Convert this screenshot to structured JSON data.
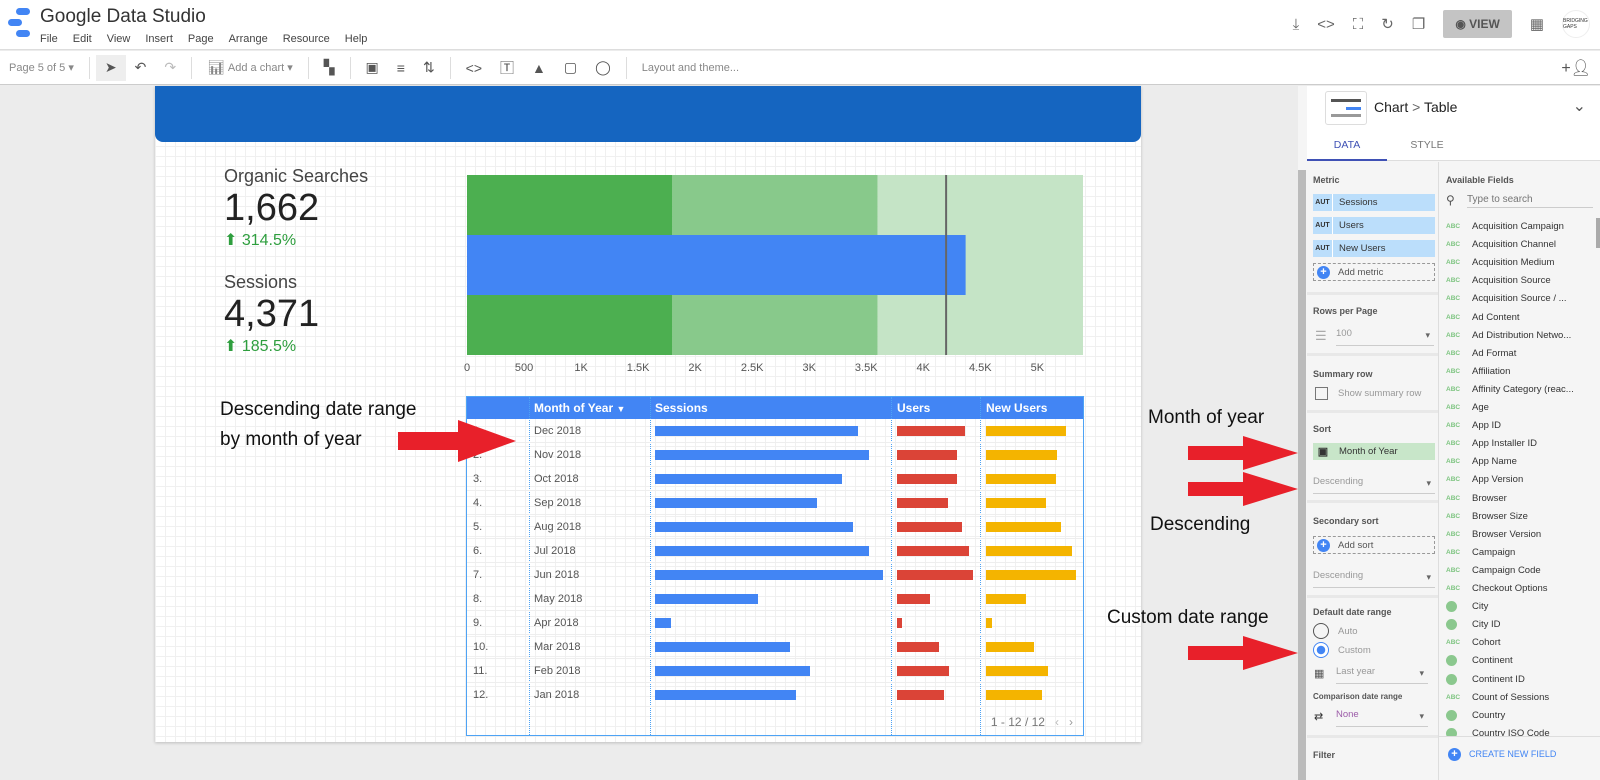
{
  "app": {
    "title": "Google Data Studio",
    "menu": [
      "File",
      "Edit",
      "View",
      "Insert",
      "Page",
      "Arrange",
      "Resource",
      "Help"
    ],
    "view_label": "VIEW",
    "avatar_text": "BRIDGING GAPS"
  },
  "toolbar": {
    "page": "Page 5 of 5",
    "add_chart": "Add a chart",
    "layout_theme": "Layout and theme..."
  },
  "scorecards": [
    {
      "label": "Organic Searches",
      "value": "1,662",
      "delta": "314.5%"
    },
    {
      "label": "Sessions",
      "value": "4,371",
      "delta": "185.5%"
    }
  ],
  "bullet_chart": {
    "value": 4371,
    "target": 4200,
    "bands": [
      1800,
      3600,
      5400
    ],
    "ticks": [
      "0",
      "500",
      "1K",
      "1.5K",
      "2K",
      "2.5K",
      "3K",
      "3.5K",
      "4K",
      "4.5K",
      "5K"
    ],
    "colors": {
      "bar": "#4285f4",
      "band1": "#4caf50",
      "band2": "#88c98b",
      "band3": "#c5e4c6",
      "target": "#666666"
    }
  },
  "table": {
    "columns": [
      "Month of Year",
      "Sessions",
      "Users",
      "New Users"
    ],
    "rows": [
      {
        "n": "1.",
        "month": "Dec 2018",
        "s": 0.89,
        "u": 0.89,
        "nu": 0.89
      },
      {
        "n": "2.",
        "month": "Nov 2018",
        "s": 0.94,
        "u": 0.79,
        "nu": 0.79
      },
      {
        "n": "3.",
        "month": "Oct 2018",
        "s": 0.82,
        "u": 0.79,
        "nu": 0.78
      },
      {
        "n": "4.",
        "month": "Sep 2018",
        "s": 0.71,
        "u": 0.67,
        "nu": 0.67
      },
      {
        "n": "5.",
        "month": "Aug 2018",
        "s": 0.87,
        "u": 0.86,
        "nu": 0.83
      },
      {
        "n": "6.",
        "month": "Jul 2018",
        "s": 0.94,
        "u": 0.95,
        "nu": 0.96
      },
      {
        "n": "7.",
        "month": "Jun 2018",
        "s": 1.0,
        "u": 1.0,
        "nu": 1.0
      },
      {
        "n": "8.",
        "month": "May 2018",
        "s": 0.45,
        "u": 0.43,
        "nu": 0.44
      },
      {
        "n": "9.",
        "month": "Apr 2018",
        "s": 0.07,
        "u": 0.07,
        "nu": 0.07
      },
      {
        "n": "10.",
        "month": "Mar 2018",
        "s": 0.59,
        "u": 0.55,
        "nu": 0.53
      },
      {
        "n": "11.",
        "month": "Feb 2018",
        "s": 0.68,
        "u": 0.68,
        "nu": 0.69
      },
      {
        "n": "12.",
        "month": "Jan 2018",
        "s": 0.62,
        "u": 0.62,
        "nu": 0.62
      }
    ],
    "pager": "1 - 12 / 12",
    "colors": {
      "sessions": "#4285f4",
      "users": "#db4437",
      "new_users": "#f4b400"
    }
  },
  "annotations": {
    "left": "Descending date range\nby month of year",
    "month": "Month of year",
    "desc": "Descending",
    "custom": "Custom date range"
  },
  "panel": {
    "breadcrumb": [
      "Chart",
      "Table"
    ],
    "tabs": [
      "DATA",
      "STYLE"
    ],
    "metric_label": "Metric",
    "metrics": [
      "Sessions",
      "Users",
      "New Users"
    ],
    "metric_type": "AUT",
    "add_metric": "Add metric",
    "rows_label": "Rows per Page",
    "rows_value": "100",
    "summary_label": "Summary row",
    "summary_check": "Show summary row",
    "sort_label": "Sort",
    "sort_field": "Month of Year",
    "sort_order": "Descending",
    "secondary_label": "Secondary sort",
    "add_sort": "Add sort",
    "secondary_order": "Descending",
    "date_label": "Default date range",
    "auto": "Auto",
    "custom": "Custom",
    "date_value": "Last year",
    "comparison_label": "Comparison date range",
    "comparison_value": "None",
    "filter_label": "Filter",
    "fields_label": "Available Fields",
    "search_placeholder": "Type to search",
    "create_field": "CREATE NEW FIELD",
    "fields": [
      {
        "t": "ABC",
        "n": "Acquisition Campaign"
      },
      {
        "t": "ABC",
        "n": "Acquisition Channel"
      },
      {
        "t": "ABC",
        "n": "Acquisition Medium"
      },
      {
        "t": "ABC",
        "n": "Acquisition Source"
      },
      {
        "t": "ABC",
        "n": "Acquisition Source / ..."
      },
      {
        "t": "ABC",
        "n": "Ad Content"
      },
      {
        "t": "ABC",
        "n": "Ad Distribution Netwo..."
      },
      {
        "t": "ABC",
        "n": "Ad Format"
      },
      {
        "t": "ABC",
        "n": "Affiliation"
      },
      {
        "t": "ABC",
        "n": "Affinity Category (reac..."
      },
      {
        "t": "ABC",
        "n": "Age"
      },
      {
        "t": "ABC",
        "n": "App ID"
      },
      {
        "t": "ABC",
        "n": "App Installer ID"
      },
      {
        "t": "ABC",
        "n": "App Name"
      },
      {
        "t": "ABC",
        "n": "App Version"
      },
      {
        "t": "ABC",
        "n": "Browser"
      },
      {
        "t": "ABC",
        "n": "Browser Size"
      },
      {
        "t": "ABC",
        "n": "Browser Version"
      },
      {
        "t": "ABC",
        "n": "Campaign"
      },
      {
        "t": "ABC",
        "n": "Campaign Code"
      },
      {
        "t": "ABC",
        "n": "Checkout Options"
      },
      {
        "t": "geo",
        "n": "City"
      },
      {
        "t": "geo",
        "n": "City ID"
      },
      {
        "t": "ABC",
        "n": "Cohort"
      },
      {
        "t": "geo",
        "n": "Continent"
      },
      {
        "t": "geo",
        "n": "Continent ID"
      },
      {
        "t": "ABC",
        "n": "Count of Sessions"
      },
      {
        "t": "geo",
        "n": "Country"
      },
      {
        "t": "geo",
        "n": "Country ISO Code"
      }
    ]
  }
}
